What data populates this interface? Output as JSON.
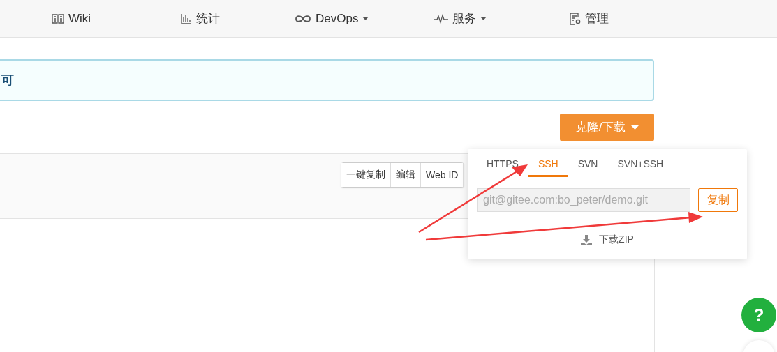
{
  "nav": [
    {
      "kind": "book",
      "label": "Wiki",
      "dropdown": false
    },
    {
      "kind": "chart",
      "label": "统计",
      "dropdown": false
    },
    {
      "kind": "infinity",
      "label": "DevOps",
      "dropdown": true
    },
    {
      "kind": "pulse",
      "label": "服务",
      "dropdown": true
    },
    {
      "kind": "doc",
      "label": "管理",
      "dropdown": false
    }
  ],
  "banner": {
    "text": "可"
  },
  "clone_button": {
    "label": "克隆/下载"
  },
  "file_actions": [
    "一键复制",
    "编辑",
    "Web ID"
  ],
  "clone_popover": {
    "tabs": [
      {
        "label": "HTTPS",
        "selected": false
      },
      {
        "label": "SSH",
        "selected": true
      },
      {
        "label": "SVN",
        "selected": false
      },
      {
        "label": "SVN+SSH",
        "selected": false
      }
    ],
    "url": "git@gitee.com:bo_peter/demo.git",
    "copy_button": "复制",
    "download": "下载ZIP"
  },
  "help_button": {
    "label": "?"
  }
}
